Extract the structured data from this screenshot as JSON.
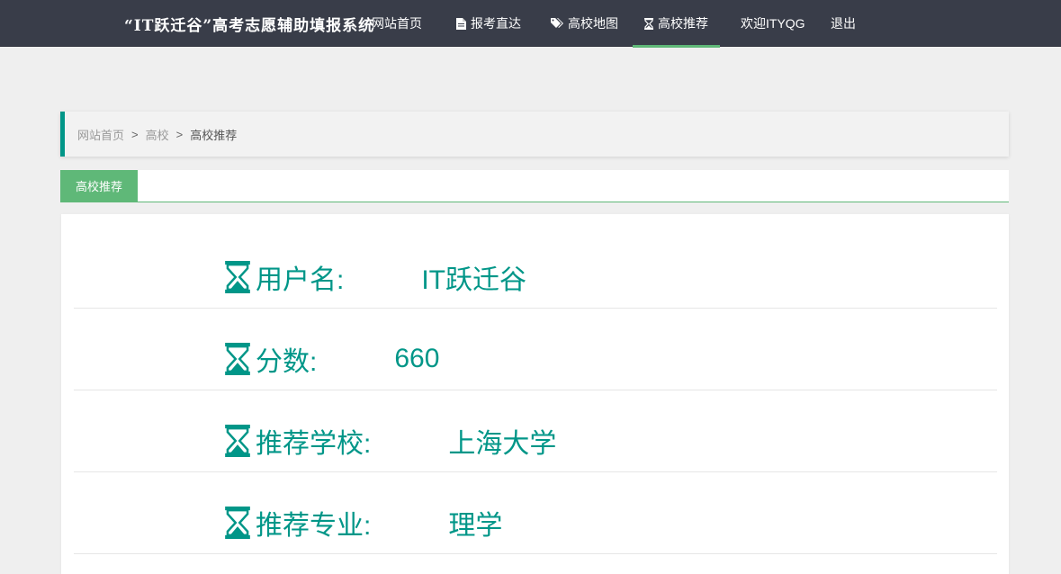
{
  "app": {
    "brand_title": "“IT跃迁谷”高考志愿辅助填报系统"
  },
  "nav": {
    "home": "网站首页",
    "report": "报考直达",
    "map": "高校地图",
    "recommend": "高校推荐",
    "welcome": "欢迎ITYQG",
    "logout": "退出"
  },
  "breadcrumb": {
    "home": "网站首页",
    "separator": ">",
    "section": "高校",
    "current": "高校推荐"
  },
  "tabs": {
    "active": "高校推荐"
  },
  "profile": {
    "rows": [
      {
        "label": "用户名:",
        "value": "IT跃迁谷"
      },
      {
        "label": "分数:",
        "value": "660"
      },
      {
        "label": "推荐学校:",
        "value": "上海大学"
      },
      {
        "label": "推荐专业:",
        "value": "理学"
      }
    ]
  },
  "colors": {
    "topbar": "#393d49",
    "accent_green": "#5fb878",
    "teal": "#009688",
    "background": "#efefef"
  },
  "icons": {
    "report": "file-icon",
    "map": "tags-icon",
    "recommend": "hourglass-icon",
    "row": "hourglass-icon"
  }
}
